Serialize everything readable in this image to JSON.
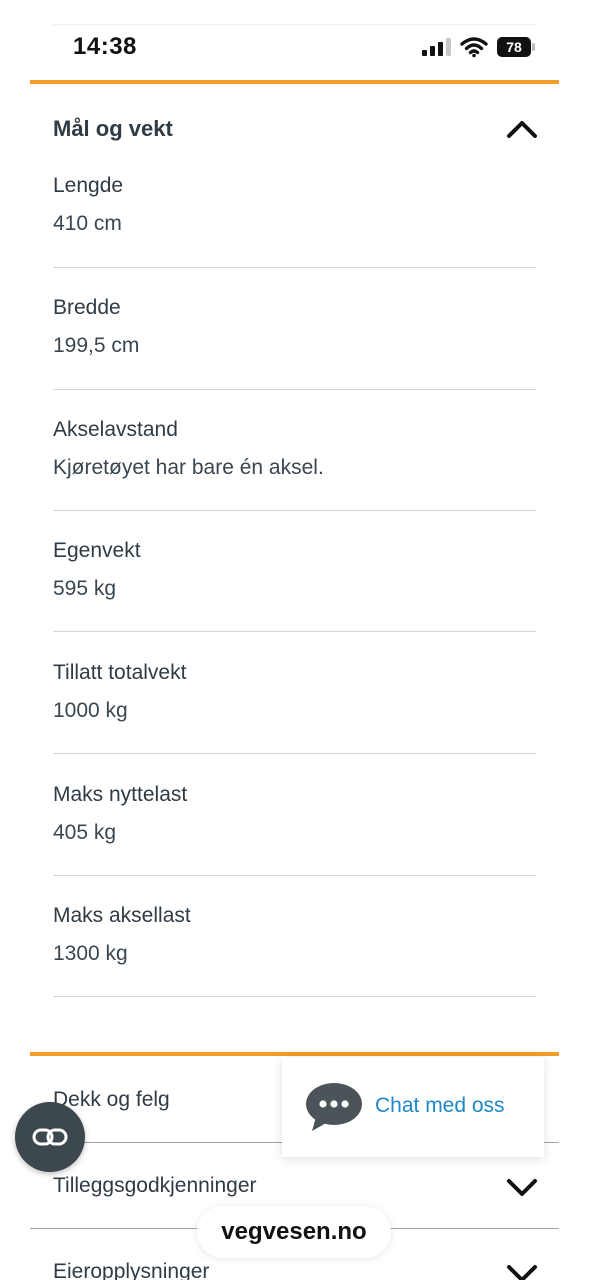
{
  "status_bar": {
    "time": "14:38",
    "battery": "78",
    "signal_bars_active": 3,
    "signal_bars_total": 4
  },
  "section": {
    "title": "Mål og vekt",
    "expanded": true,
    "rows": [
      {
        "label": "Lengde",
        "value": "410 cm"
      },
      {
        "label": "Bredde",
        "value": "199,5 cm"
      },
      {
        "label": "Akselavstand",
        "value": "Kjøretøyet har bare én aksel."
      },
      {
        "label": "Egenvekt",
        "value": "595 kg"
      },
      {
        "label": "Tillatt totalvekt",
        "value": "1000 kg"
      },
      {
        "label": "Maks nyttelast",
        "value": "405 kg"
      },
      {
        "label": "Maks aksellast",
        "value": "1300 kg"
      }
    ]
  },
  "collapsed_sections": [
    {
      "title": "Dekk og felg"
    },
    {
      "title": "Tilleggsgodkjenninger"
    },
    {
      "title": "Eieropplysninger"
    }
  ],
  "chat": {
    "label": "Chat med oss"
  },
  "browser": {
    "url": "vegvesen.no"
  },
  "colors": {
    "accent": "#f39c26",
    "text": "#2f3b45",
    "link": "#1e88c9",
    "chat_icon": "#4a5459"
  },
  "icons": {
    "collapse": "chevron-up-icon",
    "expand": "chevron-down-icon",
    "chat": "chat-bubble-icon",
    "reader": "reader-mode-icon"
  }
}
